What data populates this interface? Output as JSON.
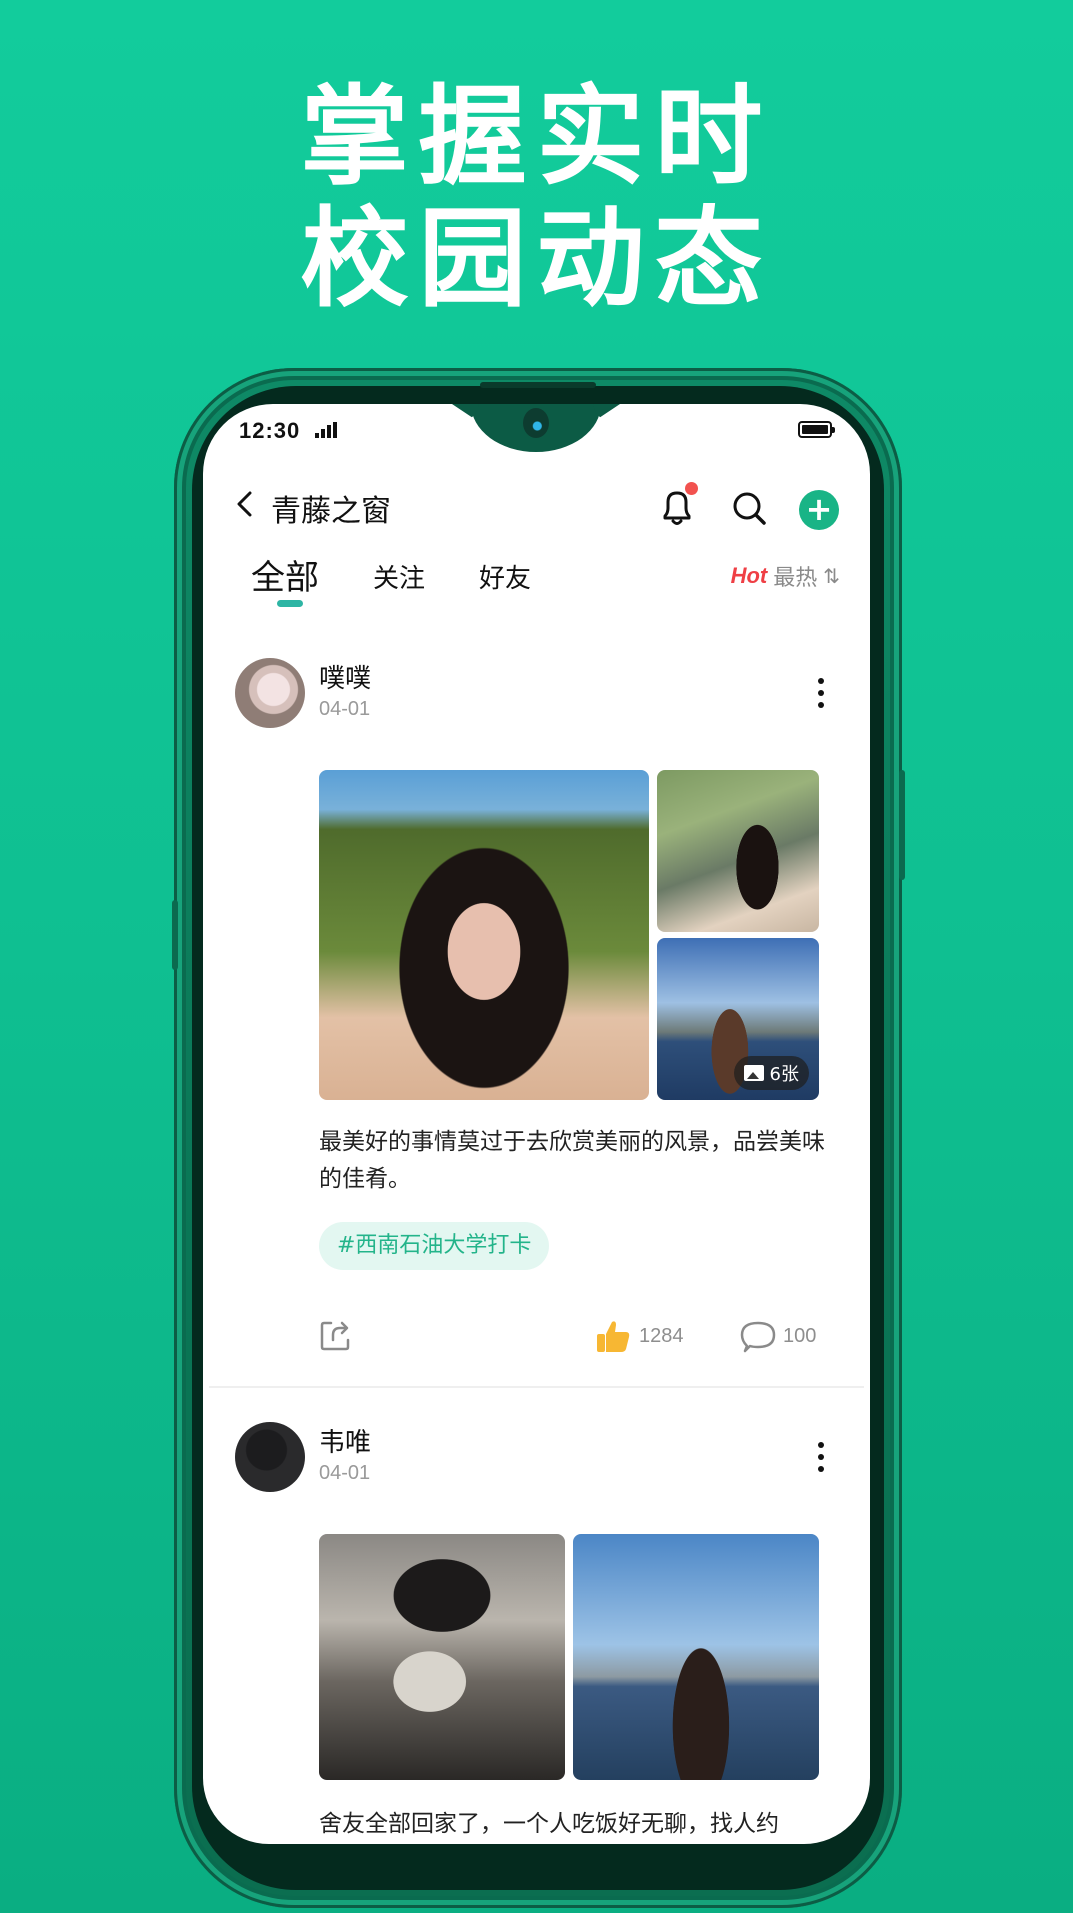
{
  "promo": {
    "headline_line1": "掌握实时",
    "headline_line2": "校园动态",
    "background_color": "#12cc9c"
  },
  "status_bar": {
    "time": "12:30",
    "signal_icon": "signal-bars-icon",
    "battery_icon": "battery-full-icon"
  },
  "app_header": {
    "back_icon": "chevron-left-icon",
    "title": "青藤之窗",
    "notification_icon": "bell-icon",
    "has_unread_notification": true,
    "search_icon": "search-icon",
    "add_icon": "plus-icon",
    "accent_color": "#19b486"
  },
  "tabs": {
    "items": [
      {
        "label": "全部",
        "active": true
      },
      {
        "label": "关注",
        "active": false
      },
      {
        "label": "好友",
        "active": false
      }
    ],
    "sort": {
      "badge": "Hot",
      "label": "最热",
      "icon": "sort-arrows-icon"
    }
  },
  "posts": [
    {
      "user": "噗噗",
      "date": "04-01",
      "more_icon": "more-vertical-icon",
      "images": [
        "photo-girl-book",
        "photo-girl-tree",
        "photo-girl-sea"
      ],
      "image_count_label": "6张",
      "text": "最美好的事情莫过于去欣赏美丽的风景，品尝美味的佳肴。",
      "topic": "#西南石油大学打卡",
      "share_icon": "share-icon",
      "like_icon": "thumbs-up-icon",
      "likes": "1284",
      "comment_icon": "comment-bubble-icon",
      "comments": "100"
    },
    {
      "user": "韦唯",
      "date": "04-01",
      "more_icon": "more-vertical-icon",
      "images": [
        "photo-boy-cat",
        "photo-boy-sea"
      ],
      "text": "舍友全部回家了，一个人吃饭好无聊，找人约"
    }
  ]
}
